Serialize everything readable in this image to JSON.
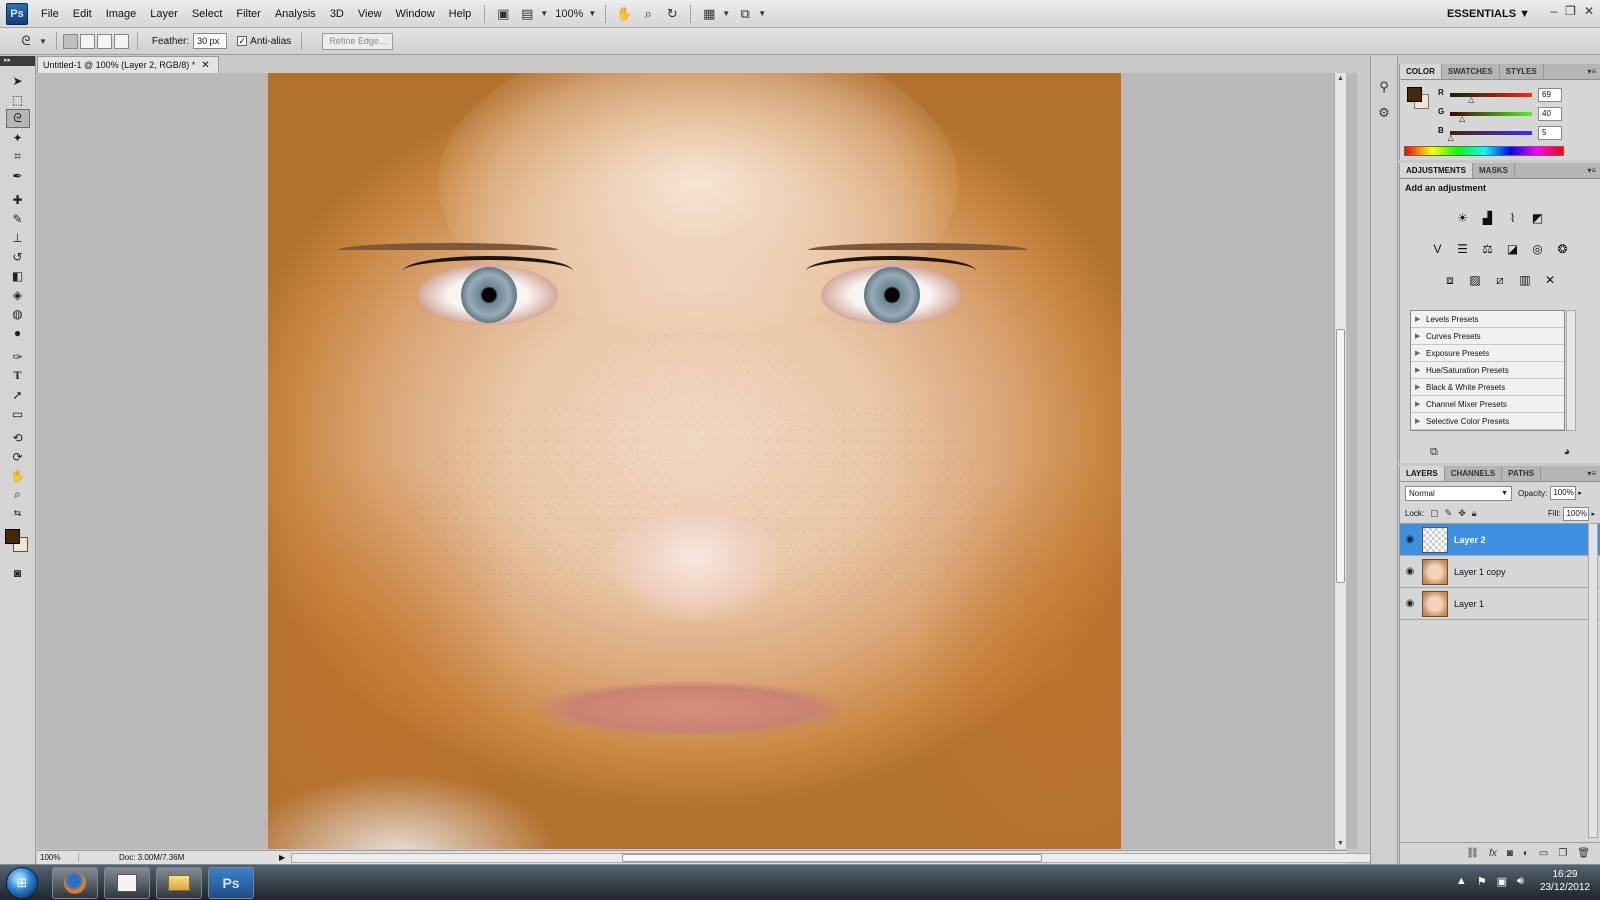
{
  "app": {
    "logo": "Ps"
  },
  "menu": [
    "File",
    "Edit",
    "Image",
    "Layer",
    "Select",
    "Filter",
    "Analysis",
    "3D",
    "View",
    "Window",
    "Help"
  ],
  "menubar": {
    "zoom": "100%",
    "workspace": "ESSENTIALS",
    "icons": [
      "bridge-icon",
      "minibridge-icon",
      "hand-icon",
      "zoom-icon",
      "rotate-icon",
      "arrange-icon",
      "screen-mode-icon"
    ]
  },
  "window_controls": [
    "–",
    "❐",
    "✕"
  ],
  "options": {
    "feather_label": "Feather:",
    "feather_value": "30 px",
    "antialias_label": "Anti-alias",
    "refine_edge": "Refine Edge..."
  },
  "document": {
    "tab_title": "Untitled-1 @ 100% (Layer 2, RGB/8) *",
    "status_zoom": "100%",
    "status_doc": "Doc: 3.00M/7.36M"
  },
  "color_panel": {
    "tabs": [
      "COLOR",
      "SWATCHES",
      "STYLES"
    ],
    "foreground": "#452805",
    "background": "#efe6cf",
    "channels": [
      {
        "label": "R",
        "value": "69",
        "fraction": 0.27
      },
      {
        "label": "G",
        "value": "40",
        "fraction": 0.16
      },
      {
        "label": "B",
        "value": "5",
        "fraction": 0.02
      }
    ]
  },
  "adjustments_panel": {
    "tabs": [
      "ADJUSTMENTS",
      "MASKS"
    ],
    "title": "Add an adjustment",
    "icon_rows": [
      [
        "brightness-icon",
        "levels-icon",
        "curves-icon",
        "exposure-icon"
      ],
      [
        "vibrance-icon",
        "hue-saturation-icon",
        "color-balance-icon",
        "black-white-icon",
        "photo-filter-icon",
        "channel-mixer-icon"
      ],
      [
        "invert-icon",
        "posterize-icon",
        "threshold-icon",
        "gradient-map-icon",
        "selective-color-icon"
      ]
    ],
    "presets": [
      "Levels Presets",
      "Curves Presets",
      "Exposure Presets",
      "Hue/Saturation Presets",
      "Black & White Presets",
      "Channel Mixer Presets",
      "Selective Color Presets"
    ]
  },
  "layers_panel": {
    "tabs": [
      "LAYERS",
      "CHANNELS",
      "PATHS"
    ],
    "blend_mode": "Normal",
    "opacity_label": "Opacity:",
    "opacity": "100%",
    "lock_label": "Lock:",
    "fill_label": "Fill:",
    "fill": "100%",
    "layers": [
      {
        "name": "Layer 2",
        "active": true,
        "thumb": "transparent"
      },
      {
        "name": "Layer 1 copy",
        "active": false,
        "thumb": "face"
      },
      {
        "name": "Layer 1",
        "active": false,
        "thumb": "face"
      }
    ]
  },
  "taskbar": {
    "apps": [
      "firefox-icon",
      "paint-icon",
      "explorer-icon",
      "photoshop-icon"
    ],
    "photoshop_label": "Ps",
    "time": "16:29",
    "date": "23/12/2012"
  },
  "colors": {
    "accent_selection": "#3d90e2",
    "skin": "#e9c7a8"
  }
}
